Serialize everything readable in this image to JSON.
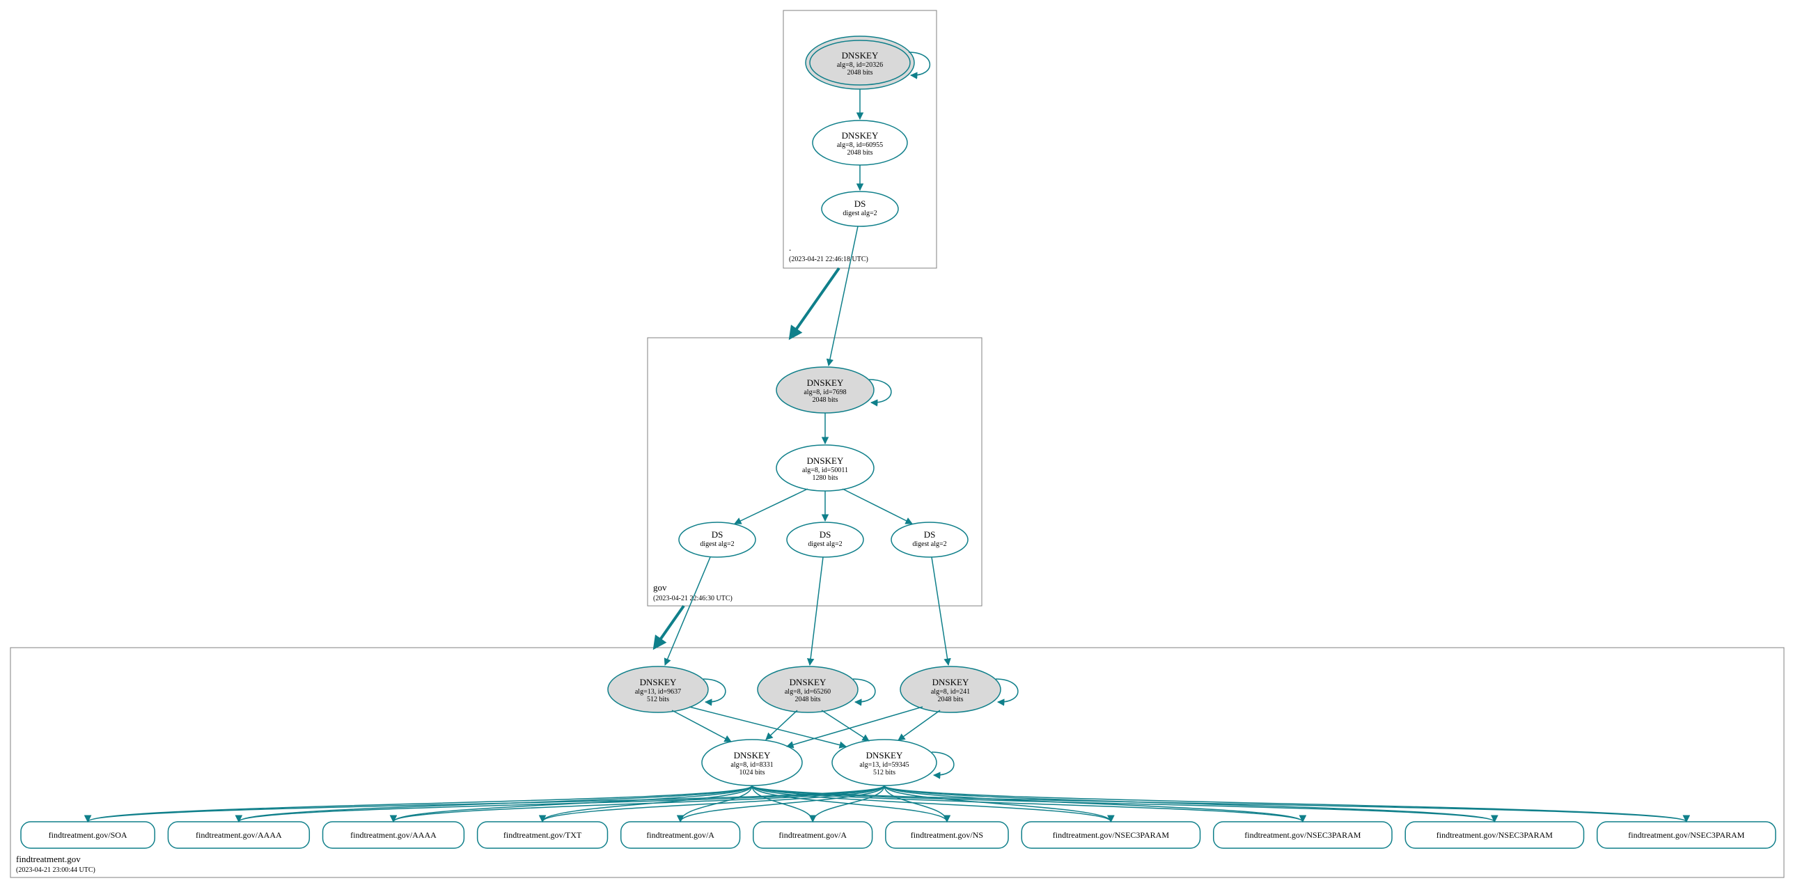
{
  "colors": {
    "teal": "#0f7f8a",
    "grey_fill": "#d9d9d9",
    "box_stroke": "#808080"
  },
  "zones": {
    "root": {
      "name": ".",
      "timestamp": "(2023-04-21 22:46:18 UTC)"
    },
    "gov": {
      "name": "gov",
      "timestamp": "(2023-04-21 22:46:30 UTC)"
    },
    "domain": {
      "name": "findtreatment.gov",
      "timestamp": "(2023-04-21 23:00:44 UTC)"
    }
  },
  "nodes": {
    "root_ksk": {
      "title": "DNSKEY",
      "line2": "alg=8, id=20326",
      "line3": "2048 bits"
    },
    "root_zsk": {
      "title": "DNSKEY",
      "line2": "alg=8, id=60955",
      "line3": "2048 bits"
    },
    "root_ds": {
      "title": "DS",
      "line2": "digest alg=2"
    },
    "gov_ksk": {
      "title": "DNSKEY",
      "line2": "alg=8, id=7698",
      "line3": "2048 bits"
    },
    "gov_zsk": {
      "title": "DNSKEY",
      "line2": "alg=8, id=50011",
      "line3": "1280 bits"
    },
    "gov_ds1": {
      "title": "DS",
      "line2": "digest alg=2"
    },
    "gov_ds2": {
      "title": "DS",
      "line2": "digest alg=2"
    },
    "gov_ds3": {
      "title": "DS",
      "line2": "digest alg=2"
    },
    "dom_k1": {
      "title": "DNSKEY",
      "line2": "alg=13, id=9637",
      "line3": "512 bits"
    },
    "dom_k2": {
      "title": "DNSKEY",
      "line2": "alg=8, id=65260",
      "line3": "2048 bits"
    },
    "dom_k3": {
      "title": "DNSKEY",
      "line2": "alg=8, id=241",
      "line3": "2048 bits"
    },
    "dom_z1": {
      "title": "DNSKEY",
      "line2": "alg=8, id=8331",
      "line3": "1024 bits"
    },
    "dom_z2": {
      "title": "DNSKEY",
      "line2": "alg=13, id=59345",
      "line3": "512 bits"
    }
  },
  "rrsets": [
    "findtreatment.gov/SOA",
    "findtreatment.gov/AAAA",
    "findtreatment.gov/AAAA",
    "findtreatment.gov/TXT",
    "findtreatment.gov/A",
    "findtreatment.gov/A",
    "findtreatment.gov/NS",
    "findtreatment.gov/NSEC3PARAM",
    "findtreatment.gov/NSEC3PARAM",
    "findtreatment.gov/NSEC3PARAM",
    "findtreatment.gov/NSEC3PARAM"
  ]
}
